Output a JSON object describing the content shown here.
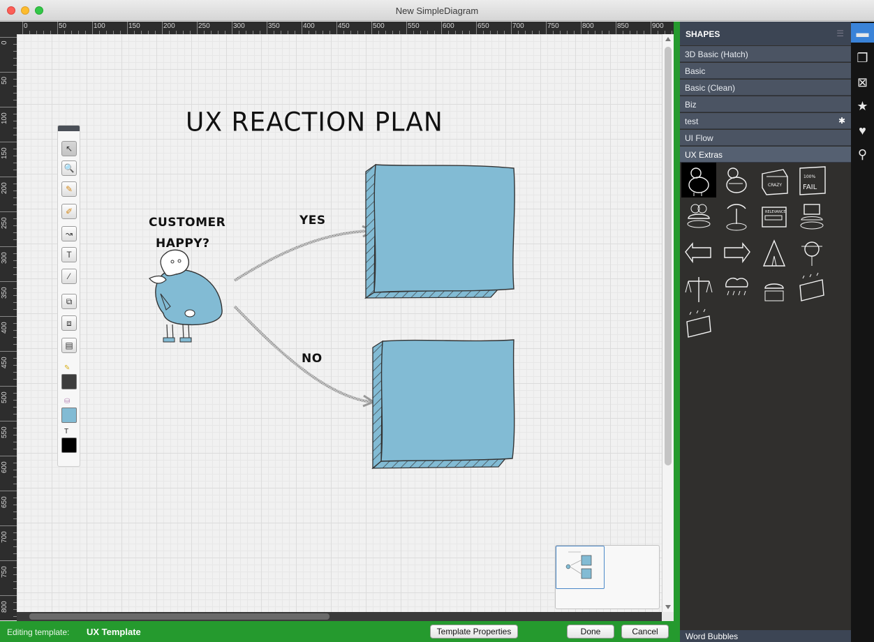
{
  "window": {
    "title": "New SimpleDiagram"
  },
  "rulers": {
    "top_labels": [
      "0",
      "50",
      "100",
      "150",
      "200",
      "250",
      "300",
      "350",
      "400",
      "450",
      "500",
      "550",
      "600",
      "650",
      "700",
      "750",
      "800",
      "850",
      "900"
    ],
    "left_labels": [
      "0",
      "50",
      "100",
      "150",
      "200",
      "250",
      "300",
      "350",
      "400",
      "450",
      "500",
      "550",
      "600",
      "650",
      "700",
      "750",
      "800"
    ]
  },
  "diagram": {
    "title": "UX REACTION PLAN",
    "question_line1": "CUSTOMER",
    "question_line2": "HAPPY?",
    "yes_label": "YES",
    "no_label": "NO",
    "box_color": "#82bbd4"
  },
  "tools": [
    {
      "name": "select-tool",
      "icon": "arrow-pointer-icon"
    },
    {
      "name": "zoom-tool",
      "icon": "magnifier-icon"
    },
    {
      "name": "pencil-tool",
      "icon": "pencil-icon"
    },
    {
      "name": "highlighter-tool",
      "icon": "highlighter-icon"
    },
    {
      "name": "connector-tool",
      "icon": "connector-icon"
    },
    {
      "name": "text-tool",
      "icon": "text-icon"
    },
    {
      "name": "eyedropper-tool",
      "icon": "eyedropper-icon"
    },
    {
      "name": "bring-front-tool",
      "icon": "bring-front-icon"
    },
    {
      "name": "send-back-tool",
      "icon": "send-back-icon"
    },
    {
      "name": "arrange-tool",
      "icon": "arrange-icon"
    }
  ],
  "colors": {
    "stroke": "#3d3d3d",
    "fill": "#82bbd4",
    "text": "#000000"
  },
  "shapes": {
    "header": "SHAPES",
    "categories": [
      {
        "label": "3D Basic (Hatch)"
      },
      {
        "label": "Basic"
      },
      {
        "label": "Basic (Clean)"
      },
      {
        "label": "Biz"
      },
      {
        "label": "test",
        "badge": "✱"
      },
      {
        "label": "UI Flow"
      },
      {
        "label": "UX Extras",
        "selected": true
      }
    ],
    "tiles": [
      "customer-shape",
      "thinking-customer-shape",
      "crazy-circles-box-shape",
      "fail-sign-shape",
      "tree-island-shape",
      "palm-island-shape",
      "relevance-bar-shape",
      "computer-on-island-shape",
      "left-arrow-sign-shape",
      "right-arrow-sign-shape",
      "teepee-shape",
      "unicycle-shape",
      "scales-shape",
      "rain-cloud-shape",
      "tree-on-box-shape",
      "sparkling-box-shape",
      "sparkling-box-2-shape"
    ],
    "footer": "Word Bubbles"
  },
  "far_right_icons": [
    "comment-icon",
    "copy-icon",
    "image-icon",
    "star-icon",
    "heart-icon",
    "search-icon"
  ],
  "bottom_bar": {
    "editing_label": "Editing template:",
    "template_name": "UX Template",
    "template_properties": "Template Properties",
    "done": "Done",
    "cancel": "Cancel"
  }
}
